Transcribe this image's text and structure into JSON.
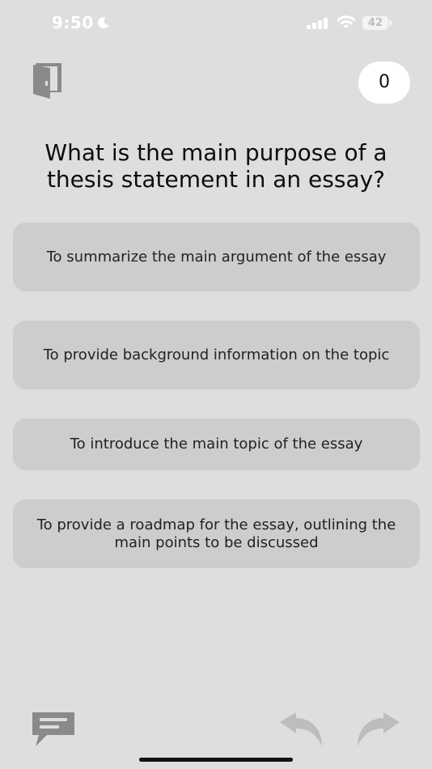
{
  "status_bar": {
    "time": "9:50",
    "battery": "42"
  },
  "header": {
    "score": "0"
  },
  "quiz": {
    "question": "What is the main purpose of a thesis statement in an essay?",
    "options": [
      "To summarize the main argument of the essay",
      "To provide background information on the topic",
      "To introduce the main topic of the essay",
      "To provide a roadmap for the essay, outlining the main points to be discussed"
    ]
  },
  "icons": {
    "status": [
      "moon-icon",
      "signal-icon",
      "wifi-icon",
      "battery-icon"
    ],
    "header": [
      "exit-door-icon"
    ],
    "footer": [
      "feedback-chat-icon",
      "undo-arrow-icon",
      "redo-arrow-icon"
    ]
  },
  "colors": {
    "background": "#dedede",
    "option_background": "#cdcdcd",
    "score_badge": "#ffffff",
    "icon_gray": "#8a8a8a",
    "nav_arrow_disabled": "#bdbdbd"
  }
}
